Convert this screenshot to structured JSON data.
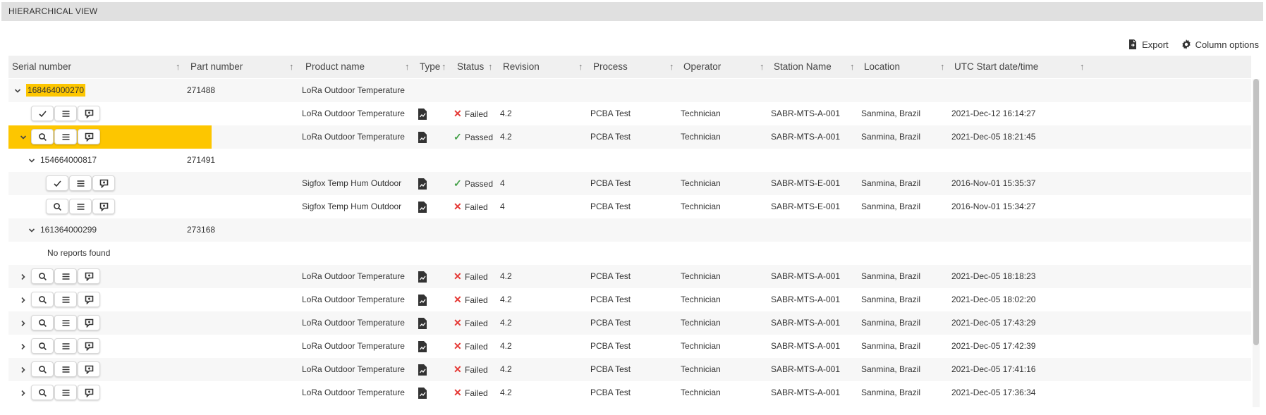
{
  "header": {
    "title": "HIERARCHICAL VIEW"
  },
  "toolbar": {
    "export_label": "Export",
    "column_options_label": "Column options"
  },
  "columns": {
    "serial": "Serial number",
    "part": "Part number",
    "product": "Product name",
    "type": "Type",
    "status": "Status",
    "revision": "Revision",
    "process": "Process",
    "operator": "Operator",
    "station": "Station Name",
    "location": "Location",
    "start": "UTC Start date/time"
  },
  "rows": [
    {
      "kind": "group",
      "level": 0,
      "serial": "168464000270",
      "part": "271488",
      "product": "LoRa Outdoor Temperature",
      "highlighted": true
    },
    {
      "kind": "report",
      "level": 1,
      "expander": "none",
      "first_action": "check",
      "product": "LoRa Outdoor Temperature",
      "status": "Failed",
      "revision": "4.2",
      "process": "PCBA Test",
      "operator": "Technician",
      "station": "SABR-MTS-A-001",
      "location": "Sanmina, Brazil",
      "start": "2021-Dec-12 16:14:27"
    },
    {
      "kind": "report",
      "level": 1,
      "expander": "down",
      "first_action": "search",
      "selected": true,
      "product": "LoRa Outdoor Temperature",
      "status": "Passed",
      "revision": "4.2",
      "process": "PCBA Test",
      "operator": "Technician",
      "station": "SABR-MTS-A-001",
      "location": "Sanmina, Brazil",
      "start": "2021-Dec-05 18:21:45"
    },
    {
      "kind": "group",
      "level": 1,
      "serial": "154664000817",
      "part": "271491"
    },
    {
      "kind": "report",
      "level": 2,
      "expander": "none",
      "first_action": "check",
      "product": "Sigfox Temp Hum Outdoor",
      "status": "Passed",
      "revision": "4",
      "process": "PCBA Test",
      "operator": "Technician",
      "station": "SABR-MTS-E-001",
      "location": "Sanmina, Brazil",
      "start": "2016-Nov-01 15:35:37"
    },
    {
      "kind": "report",
      "level": 2,
      "expander": "none",
      "first_action": "search",
      "product": "Sigfox Temp Hum Outdoor",
      "status": "Failed",
      "revision": "4",
      "process": "PCBA Test",
      "operator": "Technician",
      "station": "SABR-MTS-E-001",
      "location": "Sanmina, Brazil",
      "start": "2016-Nov-01 15:34:27"
    },
    {
      "kind": "group",
      "level": 1,
      "serial": "161364000299",
      "part": "273168"
    },
    {
      "kind": "empty",
      "level": 2,
      "text": "No reports found"
    },
    {
      "kind": "report",
      "level": 1,
      "expander": "right",
      "first_action": "search",
      "product": "LoRa Outdoor Temperature",
      "status": "Failed",
      "revision": "4.2",
      "process": "PCBA Test",
      "operator": "Technician",
      "station": "SABR-MTS-A-001",
      "location": "Sanmina, Brazil",
      "start": "2021-Dec-05 18:18:23"
    },
    {
      "kind": "report",
      "level": 1,
      "expander": "right",
      "first_action": "search",
      "product": "LoRa Outdoor Temperature",
      "status": "Failed",
      "revision": "4.2",
      "process": "PCBA Test",
      "operator": "Technician",
      "station": "SABR-MTS-A-001",
      "location": "Sanmina, Brazil",
      "start": "2021-Dec-05 18:02:20"
    },
    {
      "kind": "report",
      "level": 1,
      "expander": "right",
      "first_action": "search",
      "product": "LoRa Outdoor Temperature",
      "status": "Failed",
      "revision": "4.2",
      "process": "PCBA Test",
      "operator": "Technician",
      "station": "SABR-MTS-A-001",
      "location": "Sanmina, Brazil",
      "start": "2021-Dec-05 17:43:29"
    },
    {
      "kind": "report",
      "level": 1,
      "expander": "right",
      "first_action": "search",
      "product": "LoRa Outdoor Temperature",
      "status": "Failed",
      "revision": "4.2",
      "process": "PCBA Test",
      "operator": "Technician",
      "station": "SABR-MTS-A-001",
      "location": "Sanmina, Brazil",
      "start": "2021-Dec-05 17:42:39"
    },
    {
      "kind": "report",
      "level": 1,
      "expander": "right",
      "first_action": "search",
      "product": "LoRa Outdoor Temperature",
      "status": "Failed",
      "revision": "4.2",
      "process": "PCBA Test",
      "operator": "Technician",
      "station": "SABR-MTS-A-001",
      "location": "Sanmina, Brazil",
      "start": "2021-Dec-05 17:41:16"
    },
    {
      "kind": "report",
      "level": 1,
      "expander": "right",
      "first_action": "search",
      "product": "LoRa Outdoor Temperature",
      "status": "Failed",
      "revision": "4.2",
      "process": "PCBA Test",
      "operator": "Technician",
      "station": "SABR-MTS-A-001",
      "location": "Sanmina, Brazil",
      "start": "2021-Dec-05 17:36:34"
    }
  ],
  "colors": {
    "accent": "#fdc600",
    "failed": "#e53935",
    "passed": "#43a047",
    "header_bg": "#e0e0e0"
  },
  "icons": {
    "export": "file-export-icon",
    "column_options": "gear-icon",
    "report_type": "chart-document-icon",
    "actions": [
      "check-icon|search-icon",
      "list-icon",
      "comment-icon"
    ]
  }
}
